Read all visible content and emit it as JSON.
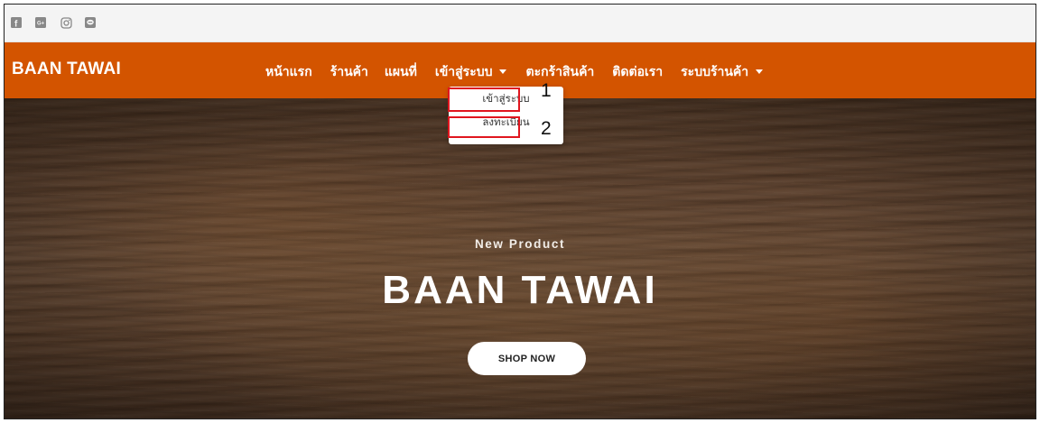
{
  "social_icons": [
    {
      "icon": "facebook-icon",
      "glyph": "f"
    },
    {
      "icon": "google-plus-icon",
      "glyph": "G+"
    },
    {
      "icon": "instagram-icon"
    },
    {
      "icon": "line-chat-icon"
    }
  ],
  "navbar": {
    "brand": "BAAN TAWAI",
    "items": [
      {
        "label": "หน้าแรก",
        "dropdown": false
      },
      {
        "label": "ร้านค้า",
        "dropdown": false
      },
      {
        "label": "แผนที่",
        "dropdown": false
      },
      {
        "label": "เข้าสู่ระบบ",
        "dropdown": true
      },
      {
        "label": "ตะกร้าสินค้า",
        "dropdown": false
      },
      {
        "label": "ติดต่อเรา",
        "dropdown": false
      },
      {
        "label": "ระบบร้านค้า",
        "dropdown": true
      }
    ]
  },
  "dropdown": {
    "items": [
      {
        "label": "เข้าสู่ระบบ",
        "annotation": "1"
      },
      {
        "label": "ลงทะเบียน",
        "annotation": "2"
      }
    ]
  },
  "hero": {
    "subtitle": "New Product",
    "title": "BAAN TAWAI",
    "button": "SHOP NOW"
  },
  "colors": {
    "navbar": "#d35400",
    "highlight": "#e0161f",
    "topbar": "#f4f4f4"
  }
}
